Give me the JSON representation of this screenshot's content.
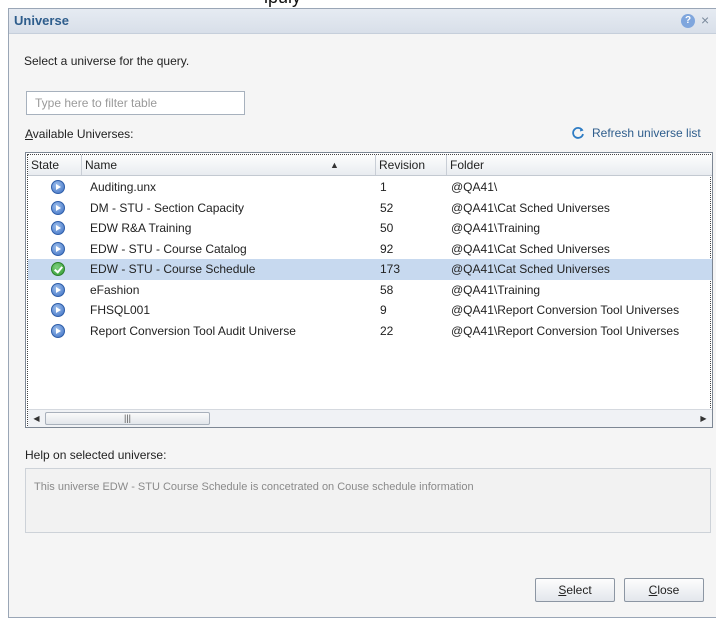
{
  "top_fragment": "ipuly",
  "dialog": {
    "title": "Universe",
    "help_icon": "question-icon",
    "close_icon": "close-icon",
    "instruction": "Select a universe for the query.",
    "filter_placeholder": "Type here to filter table",
    "available_label_accel": "A",
    "available_label_rest": "vailable Universes:",
    "refresh_label": "Refresh universe list",
    "columns": {
      "state": "State",
      "name": "Name",
      "revision": "Revision",
      "folder": "Folder"
    },
    "rows": [
      {
        "state": "arrow",
        "name": "Auditing.unx",
        "revision": "1",
        "folder": "@QA41\\"
      },
      {
        "state": "arrow",
        "name": "DM - STU - Section Capacity",
        "revision": "52",
        "folder": "@QA41\\Cat Sched Universes"
      },
      {
        "state": "arrow",
        "name": "EDW R&A Training",
        "revision": "50",
        "folder": "@QA41\\Training"
      },
      {
        "state": "arrow",
        "name": "EDW - STU - Course Catalog",
        "revision": "92",
        "folder": "@QA41\\Cat Sched Universes"
      },
      {
        "state": "check",
        "name": "EDW - STU - Course Schedule",
        "revision": "173",
        "folder": "@QA41\\Cat Sched Universes",
        "selected": true
      },
      {
        "state": "arrow",
        "name": "eFashion",
        "revision": "58",
        "folder": "@QA41\\Training"
      },
      {
        "state": "arrow",
        "name": "FHSQL001",
        "revision": "9",
        "folder": "@QA41\\Report Conversion Tool Universes"
      },
      {
        "state": "arrow",
        "name": "Report Conversion Tool Audit Universe",
        "revision": "22",
        "folder": "@QA41\\Report Conversion Tool Universes"
      }
    ],
    "help_label": "Help on selected universe:",
    "help_text": "This universe EDW - STU Course Schedule is concetrated on Couse schedule information",
    "select_accel": "S",
    "select_rest": "elect",
    "close_accel": "C",
    "close_rest": "lose"
  }
}
